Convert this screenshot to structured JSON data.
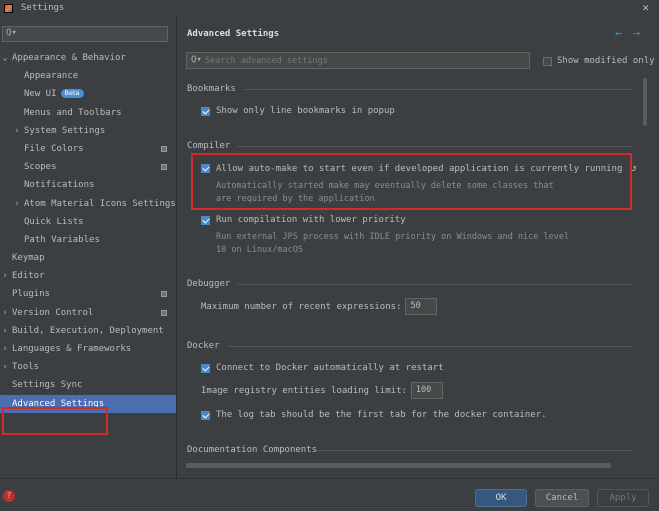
{
  "window": {
    "title": "Settings",
    "close_glyph": "✕",
    "logo_icon": "intellij-logo-icon"
  },
  "sidebar": {
    "search_glyph": "Q▾",
    "items": [
      {
        "label": "Appearance & Behavior",
        "arrow": "⌄",
        "indent": 0,
        "bold": true
      },
      {
        "label": "Appearance",
        "indent": 1
      },
      {
        "label": "New UI",
        "indent": 1,
        "badge": "Beta"
      },
      {
        "label": "Menus and Toolbars",
        "indent": 1
      },
      {
        "label": "System Settings",
        "arrow": "›",
        "indent": 1
      },
      {
        "label": "File Colors",
        "indent": 1,
        "icon": true
      },
      {
        "label": "Scopes",
        "indent": 1,
        "icon": true
      },
      {
        "label": "Notifications",
        "indent": 1
      },
      {
        "label": "Atom Material Icons Settings",
        "arrow": "›",
        "indent": 1
      },
      {
        "label": "Quick Lists",
        "indent": 1
      },
      {
        "label": "Path Variables",
        "indent": 1
      },
      {
        "label": "Keymap",
        "indent": 0,
        "bold": true
      },
      {
        "label": "Editor",
        "arrow": "›",
        "indent": 0,
        "bold": true
      },
      {
        "label": "Plugins",
        "indent": 0,
        "bold": true,
        "icon": true
      },
      {
        "label": "Version Control",
        "arrow": "›",
        "indent": 0,
        "bold": true,
        "icon": true
      },
      {
        "label": "Build, Execution, Deployment",
        "arrow": "›",
        "indent": 0,
        "bold": true
      },
      {
        "label": "Languages & Frameworks",
        "arrow": "›",
        "indent": 0,
        "bold": true
      },
      {
        "label": "Tools",
        "arrow": "›",
        "indent": 0,
        "bold": true
      },
      {
        "label": "Settings Sync",
        "indent": 0,
        "bold": true
      },
      {
        "label": "Advanced Settings",
        "indent": 0,
        "bold": true,
        "selected": true
      }
    ]
  },
  "main": {
    "title": "Advanced Settings",
    "nav_back": "←",
    "nav_forward": "→",
    "search": {
      "glyph": "Q▾",
      "placeholder": "Search advanced settings"
    },
    "show_modified_label": "Show modified only",
    "bookmarks": {
      "title": "Bookmarks",
      "option": "Show only line bookmarks in popup"
    },
    "compiler": {
      "title": "Compiler",
      "auto_make_label": "Allow auto-make to start even if developed application is currently running",
      "auto_make_reset": "↺",
      "auto_make_desc_1": "Automatically started make may eventually delete some classes that",
      "auto_make_desc_2": "are required by the application",
      "low_priority_label": "Run compilation with lower priority",
      "low_priority_desc_1": "Run external JPS process with IDLE priority on Windows and nice level",
      "low_priority_desc_2": "10 on Linux/macOS"
    },
    "debugger": {
      "title": "Debugger",
      "max_expr_label": "Maximum number of recent expressions:",
      "max_expr_value": "50"
    },
    "docker": {
      "title": "Docker",
      "connect_label": "Connect to Docker automatically at restart",
      "registry_label": "Image registry entities loading limit:",
      "registry_value": "100",
      "log_tab_label": "The log tab should be the first tab for the docker container."
    },
    "documentation": {
      "title": "Documentation Components"
    }
  },
  "footer": {
    "help_glyph": "?",
    "ok": "OK",
    "cancel": "Cancel",
    "apply": "Apply"
  },
  "colors": {
    "background": "#3c3f41",
    "selection": "#4b6eaf",
    "accent": "#4a88c7",
    "highlight_box": "#d52a2a",
    "ok_button": "#365880"
  }
}
